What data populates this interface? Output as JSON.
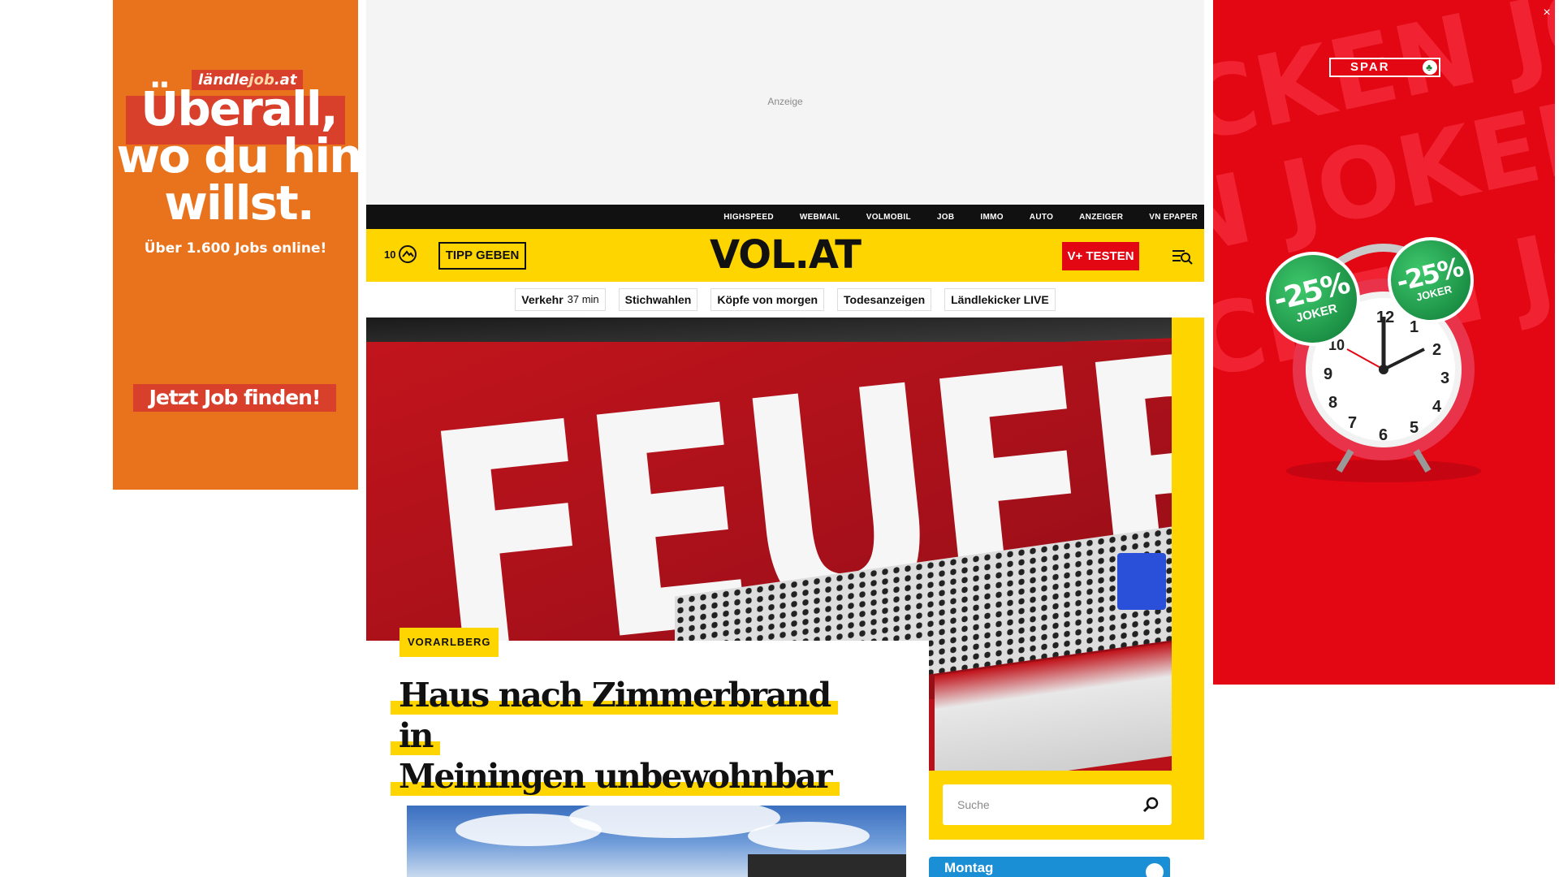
{
  "ads": {
    "left": {
      "brand_prefix": "ländle",
      "brand_highlight": "job",
      "brand_suffix": ".at",
      "headline_line1": "Überall,",
      "headline_line2": "wo du hin",
      "headline_line3": "willst.",
      "subline": "Über 1.600 Jobs online!",
      "cta": "Jetzt Job finden!"
    },
    "top": {
      "label": "Anzeige"
    },
    "right": {
      "brand": "SPAR",
      "bg_text_1": "CKEN JOKE",
      "bg_text_2": "N JOKER J",
      "bg_text_3": "CKEN JOK",
      "badge_1": "-25%",
      "badge_1_sub": "JOKER",
      "badge_2": "-25%",
      "badge_2_sub": "JOKER",
      "clock_numbers": [
        "12",
        "1",
        "2",
        "3",
        "4",
        "5",
        "6",
        "7",
        "8",
        "9",
        "10"
      ]
    },
    "close_label": "×"
  },
  "topbar": {
    "links": [
      "HIGHSPEED",
      "WEBMAIL",
      "VOLMOBIL",
      "JOB",
      "IMMO",
      "AUTO",
      "ANZEIGER",
      "VN EPAPER"
    ]
  },
  "header": {
    "weather_temp": "10",
    "tipp_label": "TIPP GEBEN",
    "logo": "VOL.AT",
    "vplus_label": "V+ TESTEN"
  },
  "quicklinks": [
    {
      "label": "Verkehr",
      "sub": "37 min"
    },
    {
      "label": "Stichwahlen"
    },
    {
      "label": "Köpfe von morgen"
    },
    {
      "label": "Todesanzeigen"
    },
    {
      "label": "Ländlekicker LIVE"
    }
  ],
  "hero": {
    "image_text": "FEUERWEHR",
    "category": "VORARLBERG",
    "title_line1": "Haus nach Zimmerbrand in",
    "title_line2": "Meiningen unbewohnbar"
  },
  "search": {
    "placeholder": "Suche"
  },
  "day_widget": {
    "label": "Montag"
  },
  "colors": {
    "brand_yellow": "#ffd500",
    "brand_red": "#e30613",
    "topbar_black": "#111111",
    "ad_orange": "#e8731c",
    "widget_blue": "#1a8fd6"
  },
  "icons": {
    "weather": "weather-icon",
    "menu": "menu-icon",
    "search": "search-icon",
    "close": "close-icon"
  }
}
